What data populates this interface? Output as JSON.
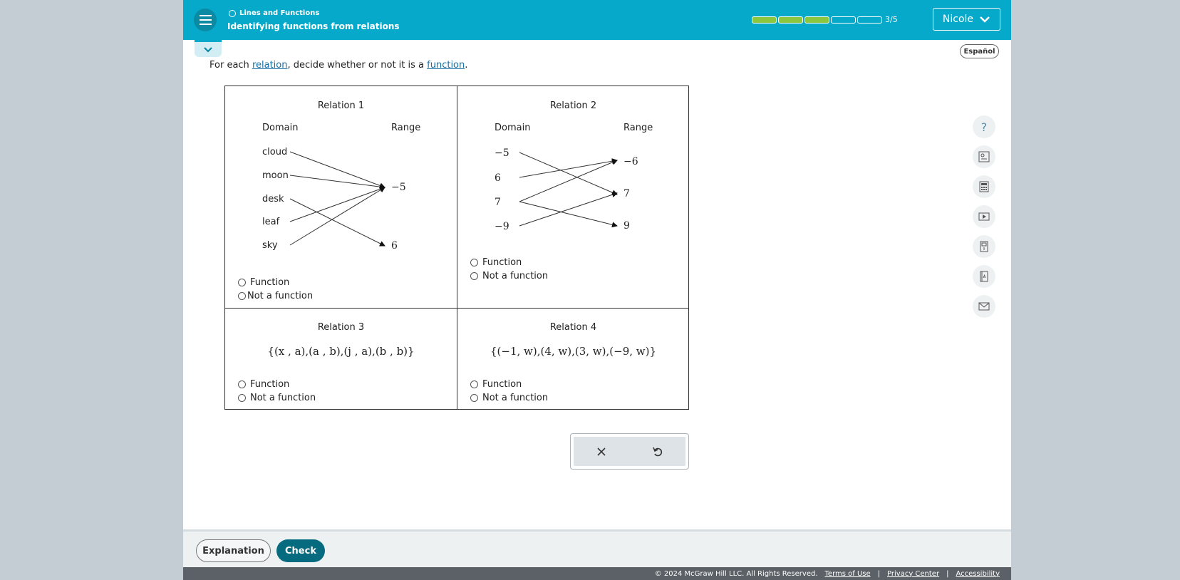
{
  "header": {
    "topic": "Lines and Functions",
    "lesson": "Identifying functions from relations",
    "progress": {
      "completed": 3,
      "total": 5,
      "label": "3/5"
    },
    "user": "Nicole"
  },
  "language_button": "Español",
  "instructions": {
    "prefix": "For each ",
    "link1": "relation",
    "middle": ", decide whether or not it is a ",
    "link2": "function",
    "suffix": "."
  },
  "relations": [
    {
      "title": "Relation 1",
      "domain_label": "Domain",
      "range_label": "Range",
      "domain": [
        "cloud",
        "moon",
        "desk",
        "leaf",
        "sky"
      ],
      "range": [
        "−5",
        "6"
      ],
      "options": [
        "Function",
        "Not a function"
      ]
    },
    {
      "title": "Relation 2",
      "domain_label": "Domain",
      "range_label": "Range",
      "domain": [
        "−5",
        "6",
        "7",
        "−9"
      ],
      "range": [
        "−6",
        "7",
        "9"
      ],
      "options": [
        "Function",
        "Not a function"
      ]
    },
    {
      "title": "Relation 3",
      "set": "{(x , a),(a , b),(j , a),(b , b)}",
      "options": [
        "Function",
        "Not a function"
      ]
    },
    {
      "title": "Relation 4",
      "set": "{(−1, w),(4, w),(3, w),(−9, w)}",
      "options": [
        "Function",
        "Not a function"
      ]
    }
  ],
  "answer_tools": {
    "clear": "clear-icon",
    "undo": "undo-icon"
  },
  "sidebar_tools": [
    "help-icon",
    "reader-icon",
    "calculator-icon",
    "video-icon",
    "ebook-icon",
    "dictionary-icon",
    "mail-icon"
  ],
  "bottom": {
    "explanation": "Explanation",
    "check": "Check"
  },
  "footer": {
    "copyright": "© 2024 McGraw Hill LLC. All Rights Reserved.",
    "terms": "Terms of Use",
    "privacy": "Privacy Center",
    "accessibility": "Accessibility",
    "sep": "|"
  },
  "colors": {
    "header": "#06a9c9",
    "check": "#066b7f",
    "progress_done": "#8cc63e"
  }
}
